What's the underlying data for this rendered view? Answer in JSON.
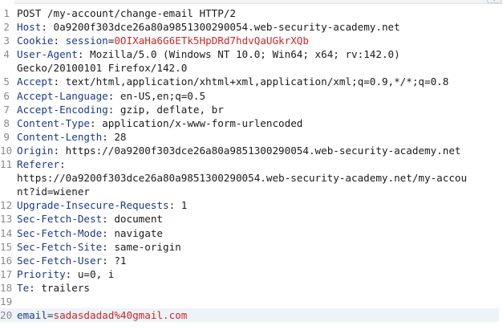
{
  "request": {
    "lines": [
      {
        "n": "1",
        "key": "",
        "sep": "",
        "value": "POST /my-account/change-email HTTP/2",
        "kind": "plain"
      },
      {
        "n": "2",
        "key": "Host",
        "sep": ": ",
        "value": "0a9200f303dce26a80a9851300290054.web-security-academy.net",
        "kind": "header"
      },
      {
        "n": "3",
        "key": "Cookie",
        "sep": ": ",
        "ckey": "session",
        "ceq": "=",
        "value": "0OIXaHa6G6ETk5HpDRd7hdvQaUGkrXQb",
        "kind": "cookie"
      },
      {
        "n": "4",
        "key": "User-Agent",
        "sep": ": ",
        "value": "Mozilla/5.0 (Windows NT 10.0; Win64; x64; rv:142.0)",
        "kind": "header"
      },
      {
        "n": "",
        "key": "",
        "sep": "",
        "value": "Gecko/20100101 Firefox/142.0",
        "kind": "plain"
      },
      {
        "n": "5",
        "key": "Accept",
        "sep": ": ",
        "value": "text/html,application/xhtml+xml,application/xml;q=0.9,*/*;q=0.8",
        "kind": "header"
      },
      {
        "n": "6",
        "key": "Accept-Language",
        "sep": ": ",
        "value": "en-US,en;q=0.5",
        "kind": "header"
      },
      {
        "n": "7",
        "key": "Accept-Encoding",
        "sep": ": ",
        "value": "gzip, deflate, br",
        "kind": "header"
      },
      {
        "n": "8",
        "key": "Content-Type",
        "sep": ": ",
        "value": "application/x-www-form-urlencoded",
        "kind": "header"
      },
      {
        "n": "9",
        "key": "Content-Length",
        "sep": ": ",
        "value": "28",
        "kind": "header"
      },
      {
        "n": "10",
        "key": "Origin",
        "sep": ": ",
        "value": "https://0a9200f303dce26a80a9851300290054.web-security-academy.net",
        "kind": "header"
      },
      {
        "n": "11",
        "key": "Referer",
        "sep": ":",
        "value": "",
        "kind": "header"
      },
      {
        "n": "",
        "key": "",
        "sep": "",
        "value": "https://0a9200f303dce26a80a9851300290054.web-security-academy.net/my-accou",
        "kind": "plain"
      },
      {
        "n": "",
        "key": "",
        "sep": "",
        "value": "nt?id=wiener",
        "kind": "plain"
      },
      {
        "n": "12",
        "key": "Upgrade-Insecure-Requests",
        "sep": ": ",
        "value": "1",
        "kind": "header"
      },
      {
        "n": "13",
        "key": "Sec-Fetch-Dest",
        "sep": ": ",
        "value": "document",
        "kind": "header"
      },
      {
        "n": "14",
        "key": "Sec-Fetch-Mode",
        "sep": ": ",
        "value": "navigate",
        "kind": "header"
      },
      {
        "n": "15",
        "key": "Sec-Fetch-Site",
        "sep": ": ",
        "value": "same-origin",
        "kind": "header"
      },
      {
        "n": "16",
        "key": "Sec-Fetch-User",
        "sep": ": ",
        "value": "?1",
        "kind": "header"
      },
      {
        "n": "17",
        "key": "Priority",
        "sep": ": ",
        "value": "u=0, i",
        "kind": "header"
      },
      {
        "n": "18",
        "key": "Te",
        "sep": ": ",
        "value": "trailers",
        "kind": "header"
      },
      {
        "n": "19",
        "key": "",
        "sep": "",
        "value": "",
        "kind": "plain"
      },
      {
        "n": "20",
        "key": "email",
        "sep": "=",
        "value": "sadasdadad%40gmail.com",
        "kind": "param"
      }
    ]
  },
  "colors": {
    "header_key": "#1c3a8a",
    "cookie_value": "#c8282a",
    "param_value": "#c8282a",
    "active_line": "#eef3f8",
    "line_number": "#8b8b8b"
  },
  "active_line_index": 22,
  "corner_icon": "expand-icon"
}
